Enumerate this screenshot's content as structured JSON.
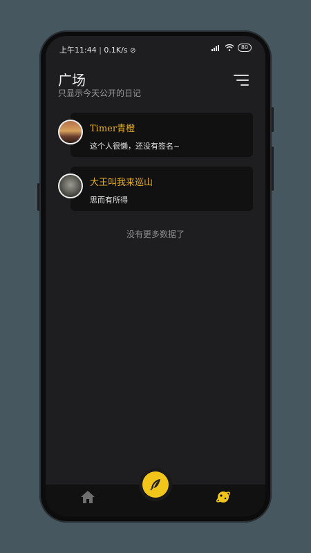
{
  "status_bar": {
    "time": "上午11:44",
    "speed": "0.1K/s",
    "battery": "80"
  },
  "header": {
    "title": "广场",
    "subtitle": "只显示今天公开的日记"
  },
  "entries": [
    {
      "name": "Timer青橙",
      "signature": "这个人很懒，还没有签名~"
    },
    {
      "name": "大王叫我来巡山",
      "signature": "思而有所得"
    }
  ],
  "list_footer": "没有更多数据了",
  "colors": {
    "accent": "#e8b021",
    "fab": "#f2c51b",
    "background": "#1e1e20",
    "card": "#111112"
  },
  "icons": {
    "filter": "filter-lines-icon",
    "fab": "feather-icon",
    "home": "home-icon",
    "plaza": "planet-icon"
  }
}
